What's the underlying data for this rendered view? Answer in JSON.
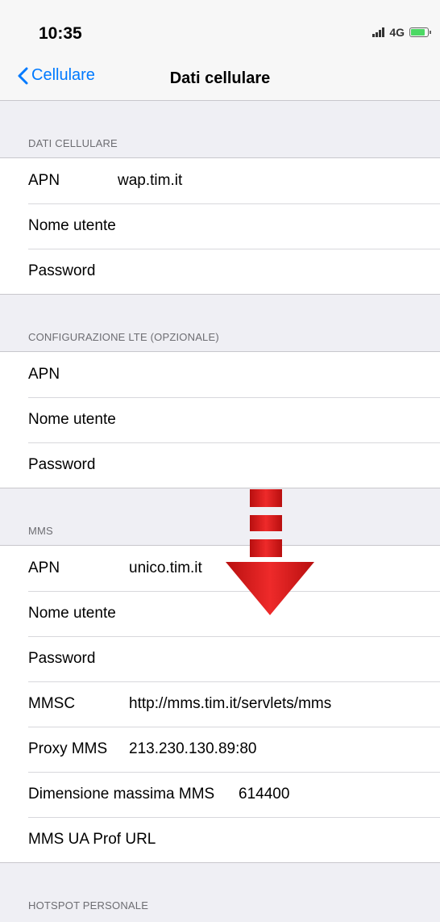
{
  "status": {
    "time": "10:35",
    "network": "4G"
  },
  "nav": {
    "back_label": "Cellulare",
    "title": "Dati cellulare"
  },
  "sections": {
    "dati": {
      "header": "DATI CELLULARE",
      "apn": {
        "label": "APN",
        "value": "wap.tim.it"
      },
      "user": {
        "label": "Nome utente",
        "value": ""
      },
      "pass": {
        "label": "Password",
        "value": ""
      }
    },
    "lte": {
      "header": "CONFIGURAZIONE LTE (OPZIONALE)",
      "apn": {
        "label": "APN",
        "value": ""
      },
      "user": {
        "label": "Nome utente",
        "value": ""
      },
      "pass": {
        "label": "Password",
        "value": ""
      }
    },
    "mms": {
      "header": "MMS",
      "apn": {
        "label": "APN",
        "value": "unico.tim.it"
      },
      "user": {
        "label": "Nome utente",
        "value": ""
      },
      "pass": {
        "label": "Password",
        "value": ""
      },
      "mmsc": {
        "label": "MMSC",
        "value": "http://mms.tim.it/servlets/mms"
      },
      "proxy": {
        "label": "Proxy MMS",
        "value": "213.230.130.89:80"
      },
      "maxsize": {
        "label": "Dimensione massima MMS",
        "value": "614400"
      },
      "uaprof": {
        "label": "MMS UA Prof URL",
        "value": ""
      }
    },
    "hotspot": {
      "header": "HOTSPOT PERSONALE"
    }
  },
  "colors": {
    "accent": "#007aff",
    "arrow": "#e01e1e",
    "background": "#efeff4"
  },
  "icons": {
    "back": "chevron-left-icon",
    "annotation": "down-arrow-icon"
  }
}
